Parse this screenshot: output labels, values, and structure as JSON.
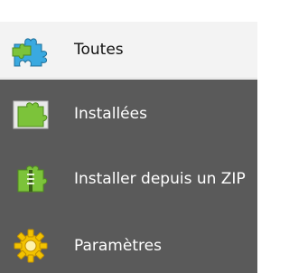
{
  "sidebar": {
    "items": [
      {
        "label": "Toutes",
        "icon": "puzzle-piece-icon",
        "active": true
      },
      {
        "label": "Installées",
        "icon": "puzzle-piece-installed-icon",
        "active": false
      },
      {
        "label": "Installer depuis un ZIP",
        "icon": "puzzle-zip-icon",
        "active": false
      },
      {
        "label": "Paramètres",
        "icon": "gear-icon",
        "active": false
      }
    ]
  },
  "colors": {
    "active_bg": "#f3f3f3",
    "dark_bg": "#5a5a5a",
    "puzzle_blue": "#3aa9e0",
    "puzzle_green": "#7cc33a",
    "gear_yellow": "#f2c200"
  }
}
